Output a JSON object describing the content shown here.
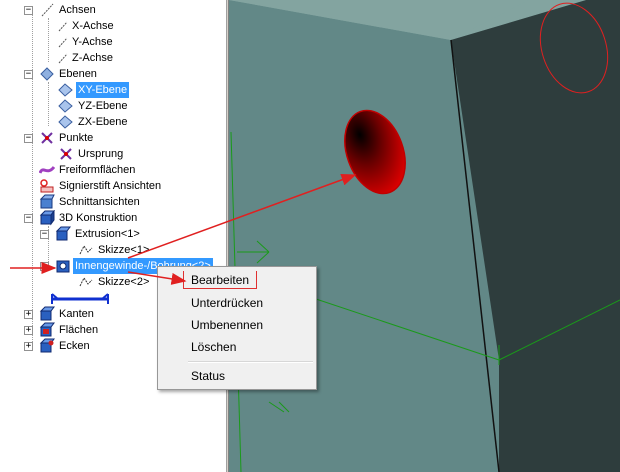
{
  "tree": {
    "nodes": [
      {
        "label": "Achsen"
      },
      {
        "label": "X-Achse"
      },
      {
        "label": "Y-Achse"
      },
      {
        "label": "Z-Achse"
      },
      {
        "label": "Ebenen"
      },
      {
        "label": "XY-Ebene"
      },
      {
        "label": "YZ-Ebene"
      },
      {
        "label": "ZX-Ebene"
      },
      {
        "label": "Punkte"
      },
      {
        "label": "Ursprung"
      },
      {
        "label": "Freiformflächen"
      },
      {
        "label": "Signierstift Ansichten"
      },
      {
        "label": "Schnittansichten"
      },
      {
        "label": "3D Konstruktion"
      },
      {
        "label": "Extrusion<1>"
      },
      {
        "label": "Skizze<1>"
      },
      {
        "label": "Innengewinde-/Bohrung<2>"
      },
      {
        "label": "Skizze<2>"
      },
      {
        "label": "Kanten"
      },
      {
        "label": "Flächen"
      },
      {
        "label": "Ecken"
      }
    ],
    "toggle_collapse": "−",
    "toggle_expand": "+"
  },
  "context_menu": {
    "items": [
      {
        "label": "Bearbeiten"
      },
      {
        "label": "Unterdrücken"
      },
      {
        "label": "Umbenennen"
      },
      {
        "label": "Löschen"
      },
      {
        "label": "Status"
      }
    ]
  },
  "colors": {
    "viewport_bg": "#628887",
    "face_top": "#83a4a0",
    "face_right": "#2e3d3d",
    "selection": "#3399ff",
    "annotation_red": "#e02020",
    "axis_green": "#1a9a1a"
  }
}
